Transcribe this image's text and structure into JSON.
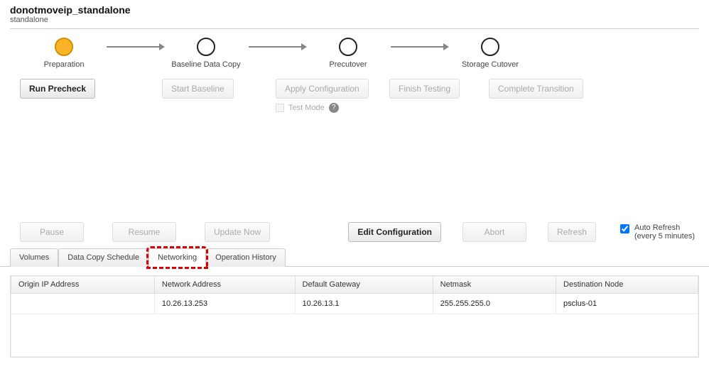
{
  "header": {
    "title": "donotmoveip_standalone",
    "subtitle": "standalone"
  },
  "workflow": {
    "steps": [
      {
        "label": "Preparation",
        "active": true
      },
      {
        "label": "Baseline Data Copy",
        "active": false
      },
      {
        "label": "Precutover",
        "active": false
      },
      {
        "label": "Storage Cutover",
        "active": false
      }
    ]
  },
  "step_buttons": {
    "run_precheck": "Run Precheck",
    "start_baseline": "Start Baseline",
    "apply_configuration": "Apply Configuration",
    "test_mode": "Test Mode",
    "finish_testing": "Finish Testing",
    "complete_transition": "Complete Transition"
  },
  "controls": {
    "pause": "Pause",
    "resume": "Resume",
    "update_now": "Update Now",
    "edit_configuration": "Edit Configuration",
    "abort": "Abort",
    "refresh": "Refresh",
    "auto_refresh_label": "Auto Refresh",
    "auto_refresh_sub": "(every 5 minutes)",
    "auto_refresh_checked": true
  },
  "tabs": [
    {
      "id": "volumes",
      "label": "Volumes",
      "active": false
    },
    {
      "id": "data-copy-schedule",
      "label": "Data Copy Schedule",
      "active": false
    },
    {
      "id": "networking",
      "label": "Networking",
      "active": true,
      "highlighted": true
    },
    {
      "id": "operation-history",
      "label": "Operation History",
      "active": false
    }
  ],
  "table": {
    "columns": [
      "Origin IP Address",
      "Network Address",
      "Default Gateway",
      "Netmask",
      "Destination Node"
    ],
    "rows": [
      {
        "origin_ip": "",
        "network_address": "10.26.13.253",
        "default_gateway": "10.26.13.1",
        "netmask": "255.255.255.0",
        "destination_node": "psclus-01"
      }
    ]
  }
}
